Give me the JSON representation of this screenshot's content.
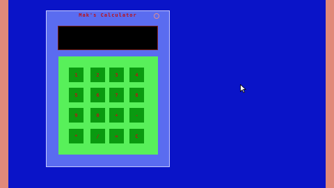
{
  "window": {
    "title": "Mak's Calculator",
    "display_value": ""
  },
  "keypad": {
    "rows": [
      [
        "1",
        "2",
        "3",
        "4"
      ],
      [
        "5",
        "6",
        "7",
        "8"
      ],
      [
        "9",
        "0",
        "+",
        "-"
      ],
      [
        "*",
        "/",
        "=",
        "C"
      ]
    ]
  },
  "colors": {
    "desktop": "#0a14c8",
    "window": "#5a6cf0",
    "keypad": "#58f05a",
    "key": "#0a9a10",
    "key_text": "#b81818",
    "frame": "#e0897a"
  }
}
